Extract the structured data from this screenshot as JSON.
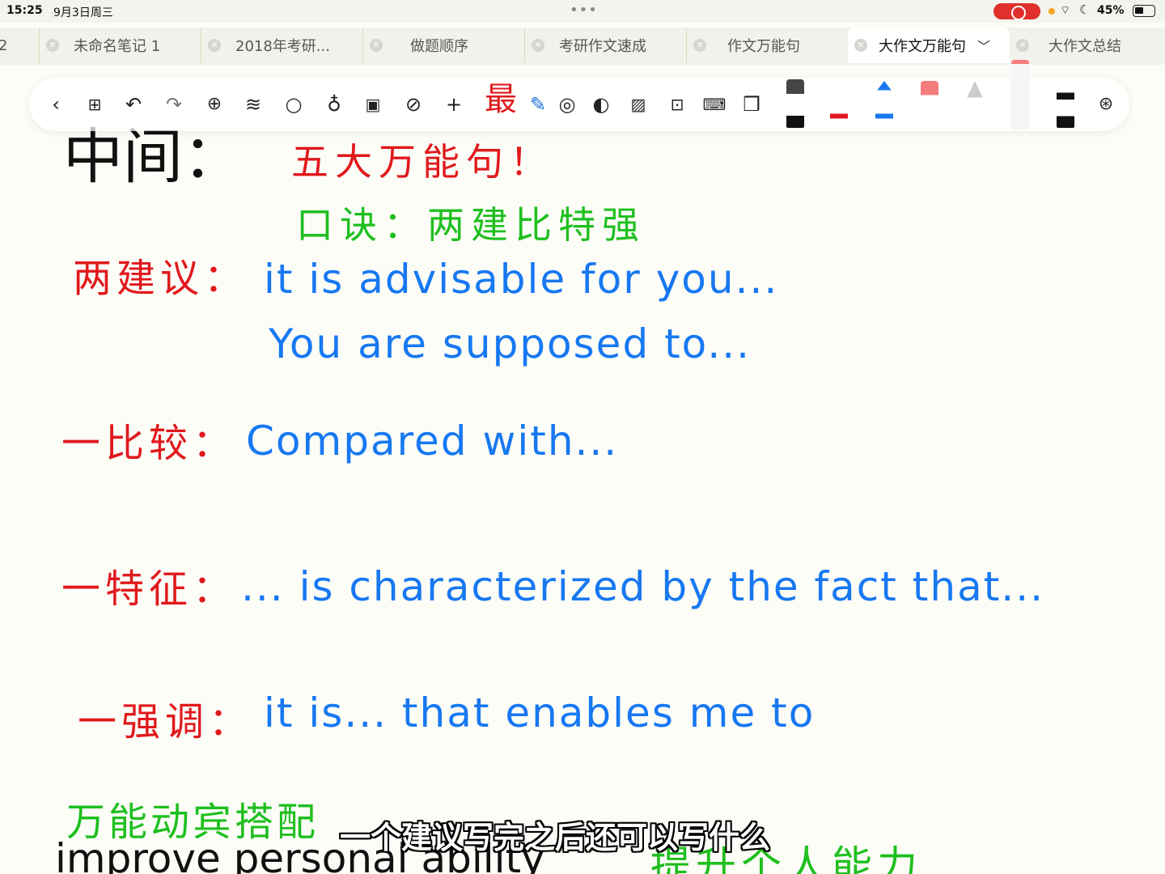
{
  "status": {
    "time": "15:25",
    "date": "9月3日周三",
    "battery": "45%"
  },
  "tabs": [
    {
      "label": "2",
      "active": false
    },
    {
      "label": "未命名笔记 1",
      "active": false
    },
    {
      "label": "2018年考研...",
      "active": false
    },
    {
      "label": "做题顺序",
      "active": false
    },
    {
      "label": "考研作文速成",
      "active": false
    },
    {
      "label": "作文万能句",
      "active": false
    },
    {
      "label": "大作文万能句",
      "active": true
    },
    {
      "label": "大作文总结",
      "active": false
    }
  ],
  "toolbar": {
    "icons": [
      "back-icon",
      "grid-icon",
      "undo-icon",
      "redo-icon",
      "add-page-icon",
      "layers-icon",
      "search-icon",
      "mic-icon",
      "clipboard-icon",
      "globe-icon",
      "plus-icon",
      "pen-icon",
      "lasso-icon",
      "shape-icon",
      "image-icon",
      "text-box-icon",
      "keyboard-icon",
      "book-icon"
    ]
  },
  "note": {
    "partial_top_left": "中间：",
    "partial_top_red": "最",
    "line_five": "五大万能句！",
    "mnemonic": "口诀：两建比特强",
    "suggest_label": "两建议：",
    "suggest_1": "it is advisable for you...",
    "suggest_2": "You are supposed to...",
    "compare_label": "一比较：",
    "compare_1": "Compared with...",
    "feature_label": "一特征：",
    "feature_1": "... is characterized by the fact that...",
    "emphasis_label": "一强调：",
    "emphasis_1": "it is... that enables me to",
    "collocation_label": "万能动宾搭配",
    "collocation_1": "improve personal ability",
    "collocation_1_cn": "提升个人能力"
  },
  "subtitle": "一个建议写完之后还可以写什么"
}
